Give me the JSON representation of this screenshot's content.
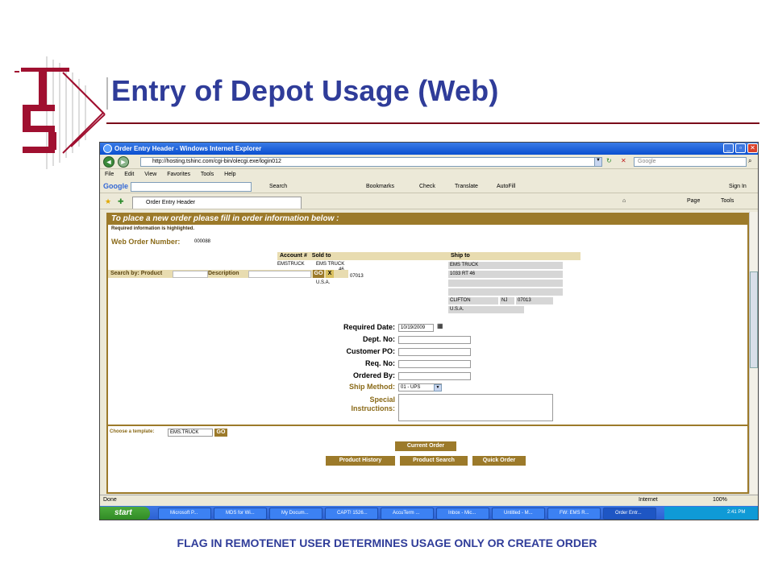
{
  "slide": {
    "title": "Entry of Depot Usage (Web)",
    "caption": "FLAG IN REMOTENET USER DETERMINES USAGE ONLY OR CREATE ORDER"
  },
  "window": {
    "title": "Order Entry Header - Windows Internet Explorer",
    "url": "http://hosting.tshinc.com/cgi-bin/olecgi.exe/login012",
    "search_placeholder": "Google",
    "menu": [
      "File",
      "Edit",
      "View",
      "Favorites",
      "Tools",
      "Help"
    ],
    "google_tools": [
      "Search",
      "Bookmarks",
      "Check",
      "Translate",
      "AutoFill"
    ],
    "tab_label": "Order Entry Header",
    "right_tools": [
      "Page",
      "Tools"
    ],
    "sign_in": "Sign In"
  },
  "form": {
    "header": "To place a new order please fill in order information below :",
    "required_note": "Required information is highlighted.",
    "order_label": "Web Order Number:",
    "order_number": "000088",
    "account_header": "Account #",
    "sold_to_header": "Sold to",
    "ship_to_header": "Ship to",
    "account": "EMSTRUCK",
    "sold_to": [
      "EMS TRUCK",
      "46",
      "., NJ 07013",
      "U.S.A."
    ],
    "ship_to": {
      "name": "EMS TRUCK",
      "address": "1033 RT 46",
      "city": "CLIFTON",
      "state": "NJ",
      "zip": "07013",
      "country": "U.S.A."
    },
    "search_by": "Search by: Product",
    "description_label": "Description",
    "go_label": "GO",
    "x_label": "X",
    "fields": {
      "required_date_label": "Required Date:",
      "required_date_value": "10/19/2009",
      "dept_label": "Dept. No:",
      "customer_po_label": "Customer PO:",
      "req_no_label": "Req. No:",
      "ordered_by_label": "Ordered By:",
      "ship_method_label": "Ship Method:",
      "ship_method_value": "01 - UPS",
      "special_label_1": "Special",
      "special_label_2": "Instructions:"
    },
    "template_label": "Choose a template:",
    "template_value": "EMS.TRUCK",
    "buttons": {
      "current_order": "Current Order",
      "product_history": "Product History",
      "product_search": "Product Search",
      "quick_order": "Quick Order"
    }
  },
  "status": {
    "text": "Done",
    "zone": "Internet",
    "zoom": "100%"
  },
  "taskbar": {
    "start": "start",
    "tasks": [
      "Microsoft P...",
      "MDS for Wi...",
      "My Docum...",
      "CAPT! 1526...",
      "AccuTerm ...",
      "Inbox - Mic...",
      "Untitled - M...",
      "FW: EMS R...",
      "Order Entr..."
    ],
    "clock": "2:41 PM"
  },
  "colors": {
    "title": "#2f3c99",
    "gold": "#9c7a2a",
    "rule": "#7a0b1a"
  }
}
